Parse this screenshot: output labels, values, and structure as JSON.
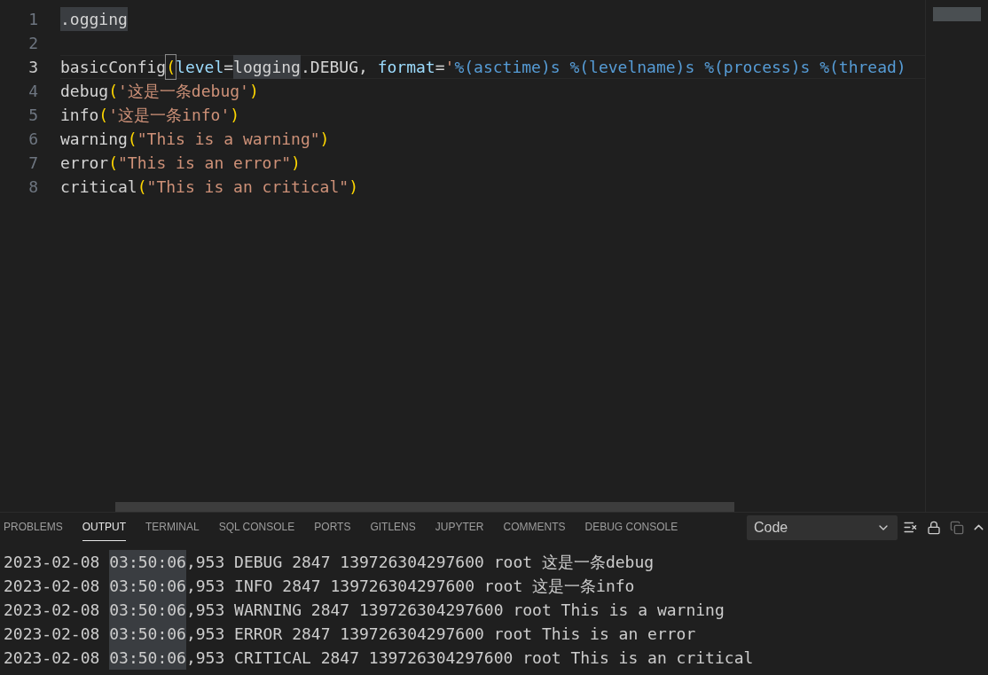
{
  "editor": {
    "lines": [
      {
        "number": "1",
        "active": false,
        "tokens": [
          {
            "kind": "plain",
            "text": ".ogging",
            "highlighted": true
          }
        ]
      },
      {
        "number": "2",
        "active": false
      },
      {
        "number": "3",
        "active": true,
        "tokens": [
          {
            "kind": "plain",
            "text": "basicConfig"
          },
          {
            "kind": "bracket",
            "text": "(",
            "highlighted": true
          },
          {
            "kind": "param",
            "text": "level"
          },
          {
            "kind": "plain",
            "text": "="
          },
          {
            "kind": "plain",
            "text": "logging",
            "highlighted": true
          },
          {
            "kind": "plain",
            "text": ".DEBUG, "
          },
          {
            "kind": "param",
            "text": "format"
          },
          {
            "kind": "plain",
            "text": "="
          },
          {
            "kind": "string",
            "text": "'"
          },
          {
            "kind": "format",
            "text": "%(asctime)s %(levelname)s %(process)s %(thread)"
          }
        ]
      },
      {
        "number": "4",
        "active": false,
        "tokens": [
          {
            "kind": "plain",
            "text": "debug"
          },
          {
            "kind": "bracket",
            "text": "("
          },
          {
            "kind": "string",
            "text": "'这是一条debug'"
          },
          {
            "kind": "bracket",
            "text": ")"
          }
        ]
      },
      {
        "number": "5",
        "active": false,
        "tokens": [
          {
            "kind": "plain",
            "text": "info"
          },
          {
            "kind": "bracket",
            "text": "("
          },
          {
            "kind": "string",
            "text": "'这是一条info'"
          },
          {
            "kind": "bracket",
            "text": ")"
          }
        ]
      },
      {
        "number": "6",
        "active": false,
        "tokens": [
          {
            "kind": "plain",
            "text": "warning"
          },
          {
            "kind": "bracket",
            "text": "("
          },
          {
            "kind": "string",
            "text": "\"This is a warning\""
          },
          {
            "kind": "bracket",
            "text": ")"
          }
        ]
      },
      {
        "number": "7",
        "active": false,
        "tokens": [
          {
            "kind": "plain",
            "text": "error"
          },
          {
            "kind": "bracket",
            "text": "("
          },
          {
            "kind": "string",
            "text": "\"This is an error\""
          },
          {
            "kind": "bracket",
            "text": ")"
          }
        ]
      },
      {
        "number": "8",
        "active": false,
        "tokens": [
          {
            "kind": "plain",
            "text": "critical"
          },
          {
            "kind": "bracket",
            "text": "("
          },
          {
            "kind": "string",
            "text": "\"This is an critical\""
          },
          {
            "kind": "bracket",
            "text": ")"
          }
        ]
      }
    ]
  },
  "panel": {
    "tabs": [
      {
        "label": "PROBLEMS",
        "selected": false
      },
      {
        "label": "OUTPUT",
        "selected": true
      },
      {
        "label": "TERMINAL",
        "selected": false
      },
      {
        "label": "SQL CONSOLE",
        "selected": false
      },
      {
        "label": "PORTS",
        "selected": false
      },
      {
        "label": "GITLENS",
        "selected": false
      },
      {
        "label": "JUPYTER",
        "selected": false
      },
      {
        "label": "COMMENTS",
        "selected": false
      },
      {
        "label": "DEBUG CONSOLE",
        "selected": false
      }
    ],
    "channel": {
      "value": "Code"
    },
    "output": [
      {
        "date": "2023-02-08 ",
        "time": "03:50:06",
        "rest": ",953 DEBUG 2847 139726304297600 root 这是一条debug"
      },
      {
        "date": "2023-02-08 ",
        "time": "03:50:06",
        "rest": ",953 INFO 2847 139726304297600 root 这是一条info"
      },
      {
        "date": "2023-02-08 ",
        "time": "03:50:06",
        "rest": ",953 WARNING 2847 139726304297600 root This is a warning"
      },
      {
        "date": "2023-02-08 ",
        "time": "03:50:06",
        "rest": ",953 ERROR 2847 139726304297600 root This is an error"
      },
      {
        "date": "2023-02-08 ",
        "time": "03:50:06",
        "rest": ",953 CRITICAL 2847 139726304297600 root This is an critical"
      }
    ]
  }
}
